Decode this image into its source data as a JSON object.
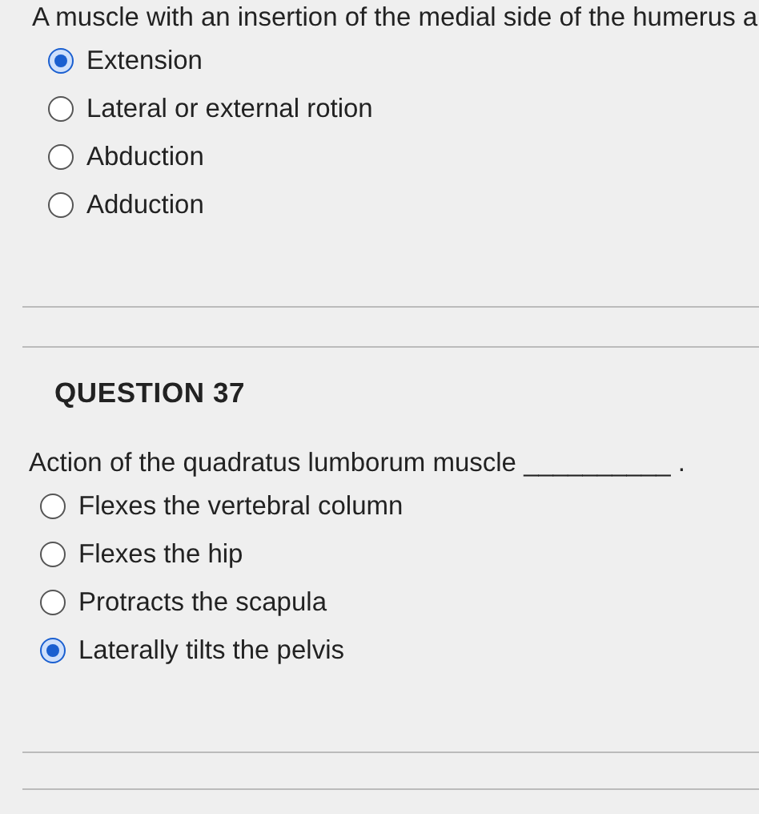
{
  "questions": [
    {
      "prompt": "A muscle with an insertion of the medial side of the humerus a",
      "options": [
        {
          "label": "Extension",
          "selected": true
        },
        {
          "label": "Lateral or external rotion",
          "selected": false
        },
        {
          "label": "Abduction",
          "selected": false
        },
        {
          "label": "Adduction",
          "selected": false
        }
      ]
    },
    {
      "title": "QUESTION 37",
      "prompt": "Action of the quadratus lumborum muscle __________ .",
      "options": [
        {
          "label": "Flexes the vertebral column",
          "selected": false
        },
        {
          "label": "Flexes the hip",
          "selected": false
        },
        {
          "label": "Protracts the scapula",
          "selected": false
        },
        {
          "label": "Laterally tilts the pelvis",
          "selected": true
        }
      ]
    }
  ]
}
